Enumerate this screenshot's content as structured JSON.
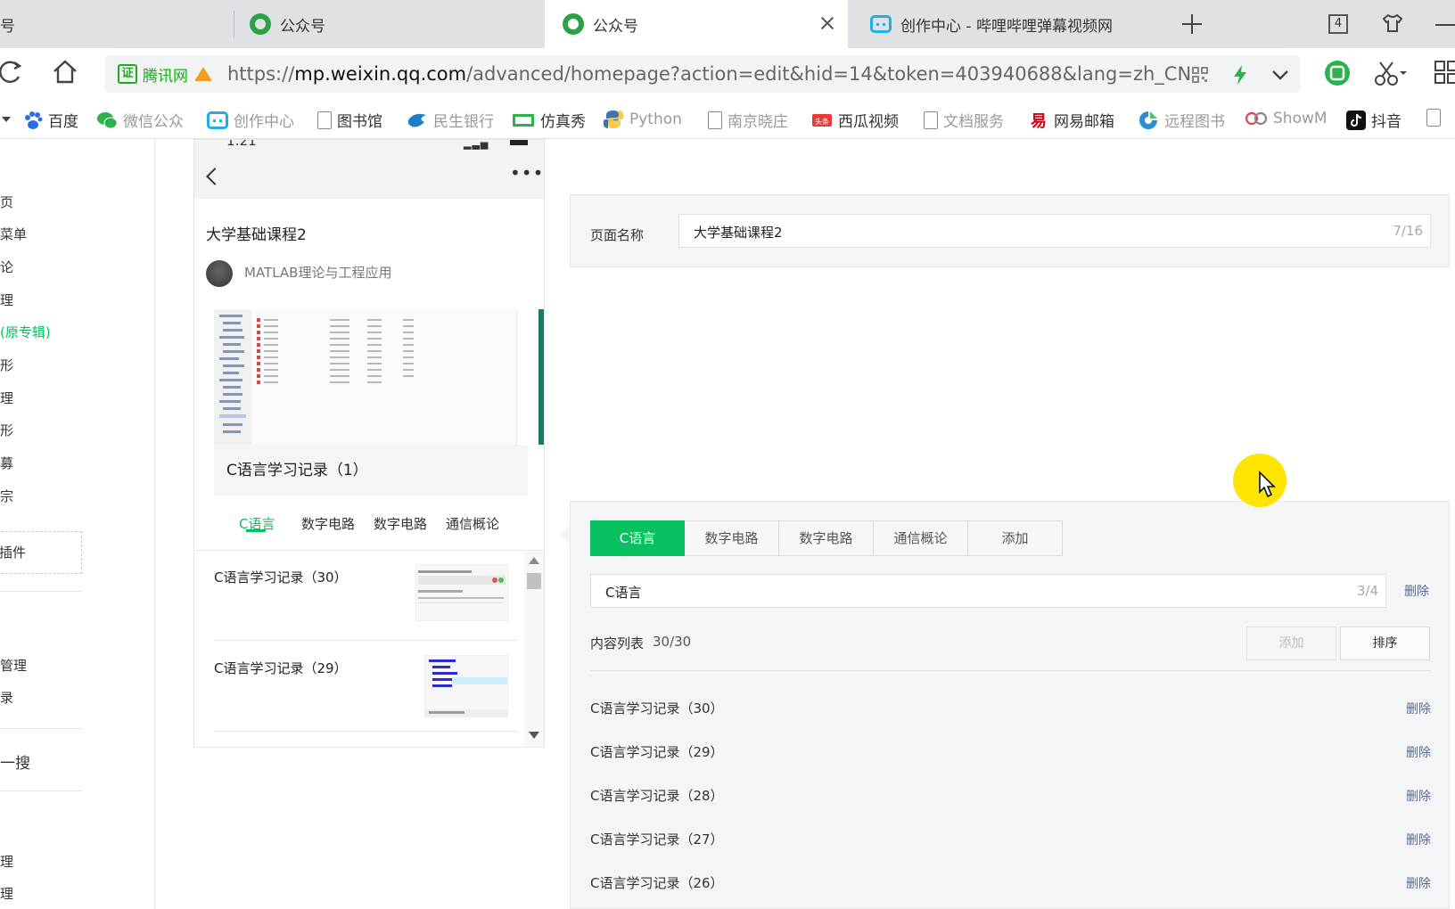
{
  "browser": {
    "tabs": [
      {
        "label": "号"
      },
      {
        "label": "公众号"
      },
      {
        "label": "公众号"
      },
      {
        "label": "创作中心 - 哔哩哔哩弹幕视频网"
      }
    ],
    "tab_count": "4",
    "cert_label": "腾讯网",
    "url_host": "mp.weixin.qq.com",
    "url_prefix": "https://",
    "url_path": "/advanced/homepage?action=edit&hid=14&token=403940688&lang=zh_CN"
  },
  "bookmarks": [
    {
      "label": "百度"
    },
    {
      "label": "微信公众"
    },
    {
      "label": "创作中心"
    },
    {
      "label": "图书馆"
    },
    {
      "label": "民生银行"
    },
    {
      "label": "仿真秀"
    },
    {
      "label": "Python"
    },
    {
      "label": "南京晓庄"
    },
    {
      "label": "西瓜视频"
    },
    {
      "label": "文档服务"
    },
    {
      "label": "网易邮箱"
    },
    {
      "label": "远程图书"
    },
    {
      "label": "ShowM"
    },
    {
      "label": "抖音"
    }
  ],
  "sidebar": {
    "items": [
      "页",
      "菜单",
      "论",
      "理",
      "(原专辑)",
      "形",
      "理",
      "形",
      "募",
      "宗"
    ],
    "plugin": "插件",
    "items2": [
      "管理",
      "录"
    ],
    "search": "一搜",
    "items3": [
      "理",
      "理"
    ]
  },
  "phone": {
    "time": "1:21",
    "page_title": "大学基础课程2",
    "author": "MATLAB理论与工程应用",
    "cover_caption": "C语言学习记录（1）",
    "tabs": [
      "C语言",
      "数字电路",
      "数字电路",
      "通信概论"
    ],
    "list": [
      "C语言学习记录（30）",
      "C语言学习记录（29）"
    ]
  },
  "editor": {
    "name_label": "页面名称",
    "name_value": "大学基础课程2",
    "name_counter": "7/16",
    "segments": [
      "C语言",
      "数字电路",
      "数字电路",
      "通信概论",
      "添加"
    ],
    "category_value": "C语言",
    "category_counter": "3/4",
    "delete_label": "删除",
    "list_label": "内容列表",
    "list_count": "30/30",
    "add_button": "添加",
    "sort_button": "排序",
    "rows": [
      "C语言学习记录（30）",
      "C语言学习记录（29）",
      "C语言学习记录（28）",
      "C语言学习记录（27）",
      "C语言学习记录（26）"
    ]
  },
  "colors": {
    "accent": "#07c160",
    "link": "#576b95"
  }
}
